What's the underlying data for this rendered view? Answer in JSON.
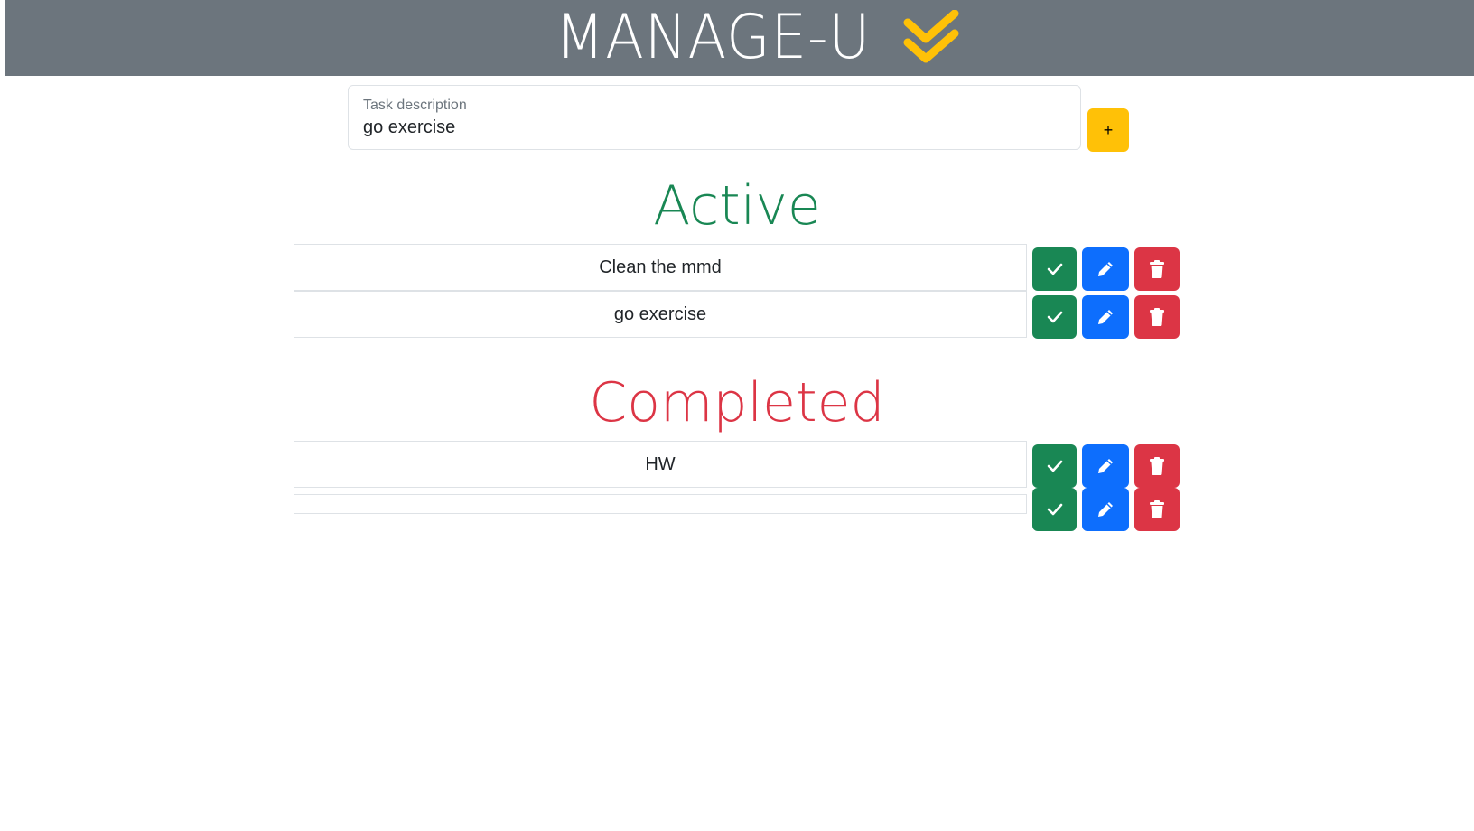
{
  "header": {
    "title": "MANAGE-U",
    "logo_icon": "double-check-icon",
    "background": "#6c757d",
    "logo_color": "#ffc107"
  },
  "new_task": {
    "label": "Task description",
    "value": "go exercise",
    "add_label": "+",
    "add_color": "#ffc107"
  },
  "active": {
    "heading": "Active",
    "color": "#198754",
    "tasks": [
      {
        "text": "Clean the mmd"
      },
      {
        "text": "go exercise"
      }
    ]
  },
  "completed": {
    "heading": "Completed",
    "color": "#dc3545",
    "tasks": [
      {
        "text": "HW"
      },
      {
        "text": ""
      }
    ]
  },
  "actions": {
    "complete_icon": "check-icon",
    "edit_icon": "pencil-icon",
    "delete_icon": "trash-icon",
    "complete_color": "#198754",
    "edit_color": "#0d6efd",
    "delete_color": "#dc3545"
  }
}
